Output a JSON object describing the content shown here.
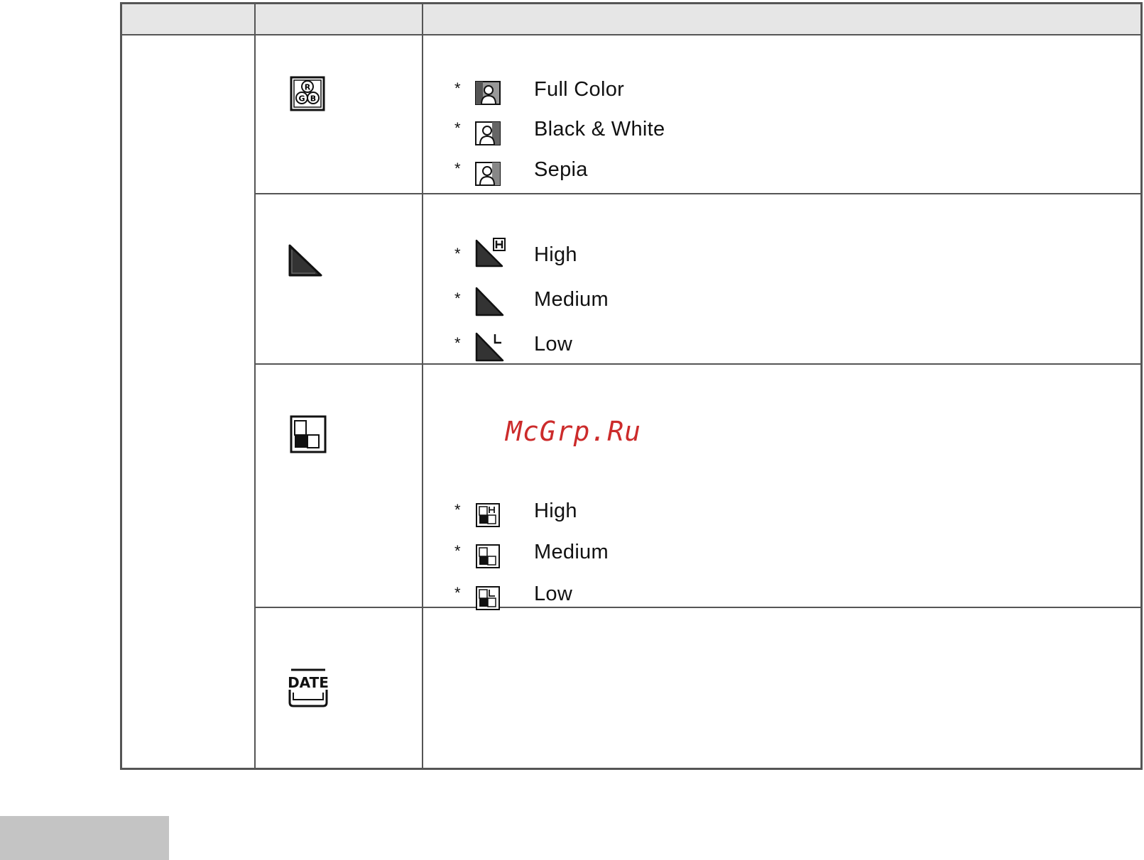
{
  "watermark": "McGrp.Ru",
  "sections": [
    {
      "id": "color",
      "icon": "rgb-color-icon",
      "options": [
        {
          "star": "*",
          "icon": "full-color-icon",
          "label": "Full Color"
        },
        {
          "star": "*",
          "icon": "black-white-icon",
          "label": "Black & White"
        },
        {
          "star": "*",
          "icon": "sepia-icon",
          "label": "Sepia"
        }
      ]
    },
    {
      "id": "sharpness",
      "icon": "sharpness-icon",
      "options": [
        {
          "star": "*",
          "icon": "sharpness-high-icon",
          "label": "High"
        },
        {
          "star": "*",
          "icon": "sharpness-medium-icon",
          "label": "Medium"
        },
        {
          "star": "*",
          "icon": "sharpness-low-icon",
          "label": "Low"
        }
      ]
    },
    {
      "id": "contrast",
      "icon": "contrast-icon",
      "options": [
        {
          "star": "*",
          "icon": "contrast-high-icon",
          "label": "High"
        },
        {
          "star": "*",
          "icon": "contrast-medium-icon",
          "label": "Medium"
        },
        {
          "star": "*",
          "icon": "contrast-low-icon",
          "label": "Low"
        }
      ]
    },
    {
      "id": "date-stamp",
      "icon": "date-stamp-icon",
      "icon_text": "DATE",
      "options": []
    }
  ]
}
